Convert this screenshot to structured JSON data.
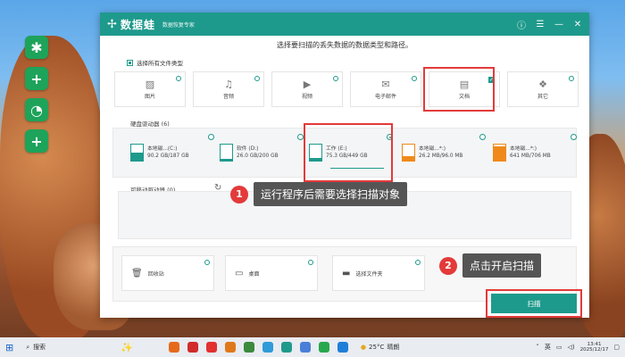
{
  "app": {
    "logo_text": "数据蛙",
    "subtitle": "数据恢复专家",
    "controls": [
      "help-icon",
      "menu-icon",
      "minimize-icon",
      "close-icon"
    ]
  },
  "heading": "选择要扫描的丢失数据的数据类型和路径。",
  "select_all": "选择所有文件类型",
  "file_types": [
    {
      "label": "图片",
      "icon": "image-icon",
      "state": "unchecked"
    },
    {
      "label": "音频",
      "icon": "audio-icon",
      "state": "unchecked"
    },
    {
      "label": "视频",
      "icon": "video-icon",
      "state": "unchecked"
    },
    {
      "label": "电子邮件",
      "icon": "email-icon",
      "state": "unchecked"
    },
    {
      "label": "文档",
      "icon": "document-icon",
      "state": "checked"
    },
    {
      "label": "其它",
      "icon": "other-icon",
      "state": "unchecked"
    }
  ],
  "hard_drives": {
    "title": "硬盘驱动器",
    "count": "(6)",
    "drives": [
      {
        "name": "本地磁...(C:)",
        "usage": "90.2 GB/187 GB",
        "selected": false,
        "fill_percent": 48,
        "color": "teal"
      },
      {
        "name": "软件 (D:)",
        "usage": "26.0 GB/200 GB",
        "selected": false,
        "fill_percent": 13,
        "color": "teal"
      },
      {
        "name": "工作 (E:)",
        "usage": "75.3 GB/449 GB",
        "selected": true,
        "fill_percent": 17,
        "color": "teal"
      },
      {
        "name": "本地磁...*:)",
        "usage": "26.2 MB/96.0 MB",
        "selected": false,
        "fill_percent": 27,
        "color": "orange"
      },
      {
        "name": "本地磁...*:)",
        "usage": "641 MB/706 MB",
        "selected": false,
        "fill_percent": 91,
        "color": "orange"
      }
    ]
  },
  "removable": {
    "title": "可移动驱动器",
    "count": "(0)"
  },
  "locations": [
    {
      "label": "回收站",
      "icon": "recycle-bin-icon"
    },
    {
      "label": "桌面",
      "icon": "desktop-icon"
    },
    {
      "label": "选择文件夹",
      "icon": "folder-icon"
    }
  ],
  "scan_button": "扫描",
  "callouts": [
    {
      "num": "1",
      "text": "运行程序后需要选择扫描对象"
    },
    {
      "num": "2",
      "text": "点击开启扫描"
    }
  ],
  "taskbar": {
    "search_placeholder": "搜索",
    "temperature": "25°C",
    "weather": "晴朗",
    "ime": "英",
    "time": "13:41",
    "date": "2025/12/17"
  },
  "colors": {
    "accent": "#1e9a8c",
    "highlight": "#e33a3a",
    "warning_drive": "#ef8a1a"
  }
}
